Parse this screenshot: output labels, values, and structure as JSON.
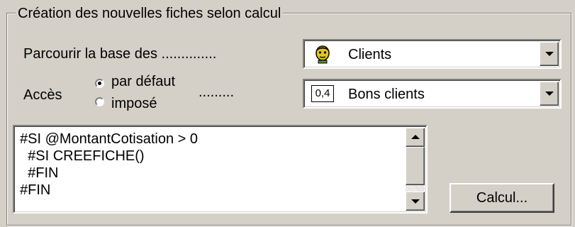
{
  "group": {
    "title": "Création des nouvelles fiches selon calcul"
  },
  "browse": {
    "label": "Parcourir la base des ..............",
    "selected": "Clients",
    "icon": "client-face-icon"
  },
  "access": {
    "label": "Accès",
    "options": [
      {
        "label": "par défaut",
        "checked": true
      },
      {
        "label": "imposé",
        "checked": false
      }
    ],
    "dots": ".........",
    "selected": "Bons clients",
    "icon_text": "0,4"
  },
  "formula": {
    "lines": [
      "#SI @MontantCotisation > 0",
      "  #SI CREEFICHE()",
      "  #FIN",
      "#FIN"
    ]
  },
  "calc_button": {
    "label": "Calcul..."
  }
}
